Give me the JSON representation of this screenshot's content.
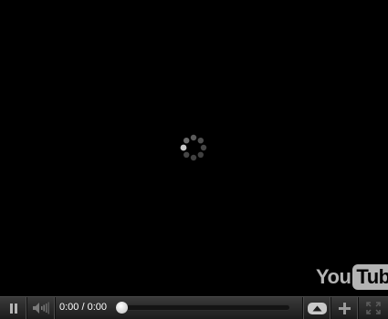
{
  "player": {
    "time_display": "0:00 / 0:00",
    "progress_fraction": 0.0,
    "logo": {
      "you": "You",
      "tube": "Tube"
    },
    "icons": {
      "pause": "pause-icon",
      "volume": "volume-icon",
      "quality": "quality-up-icon",
      "more": "plus-icon",
      "fullscreen": "fullscreen-icon",
      "spinner": "loading-spinner-icon"
    },
    "colors": {
      "progress_fill": "#bb0000",
      "icon": "#b5b5b5"
    }
  }
}
